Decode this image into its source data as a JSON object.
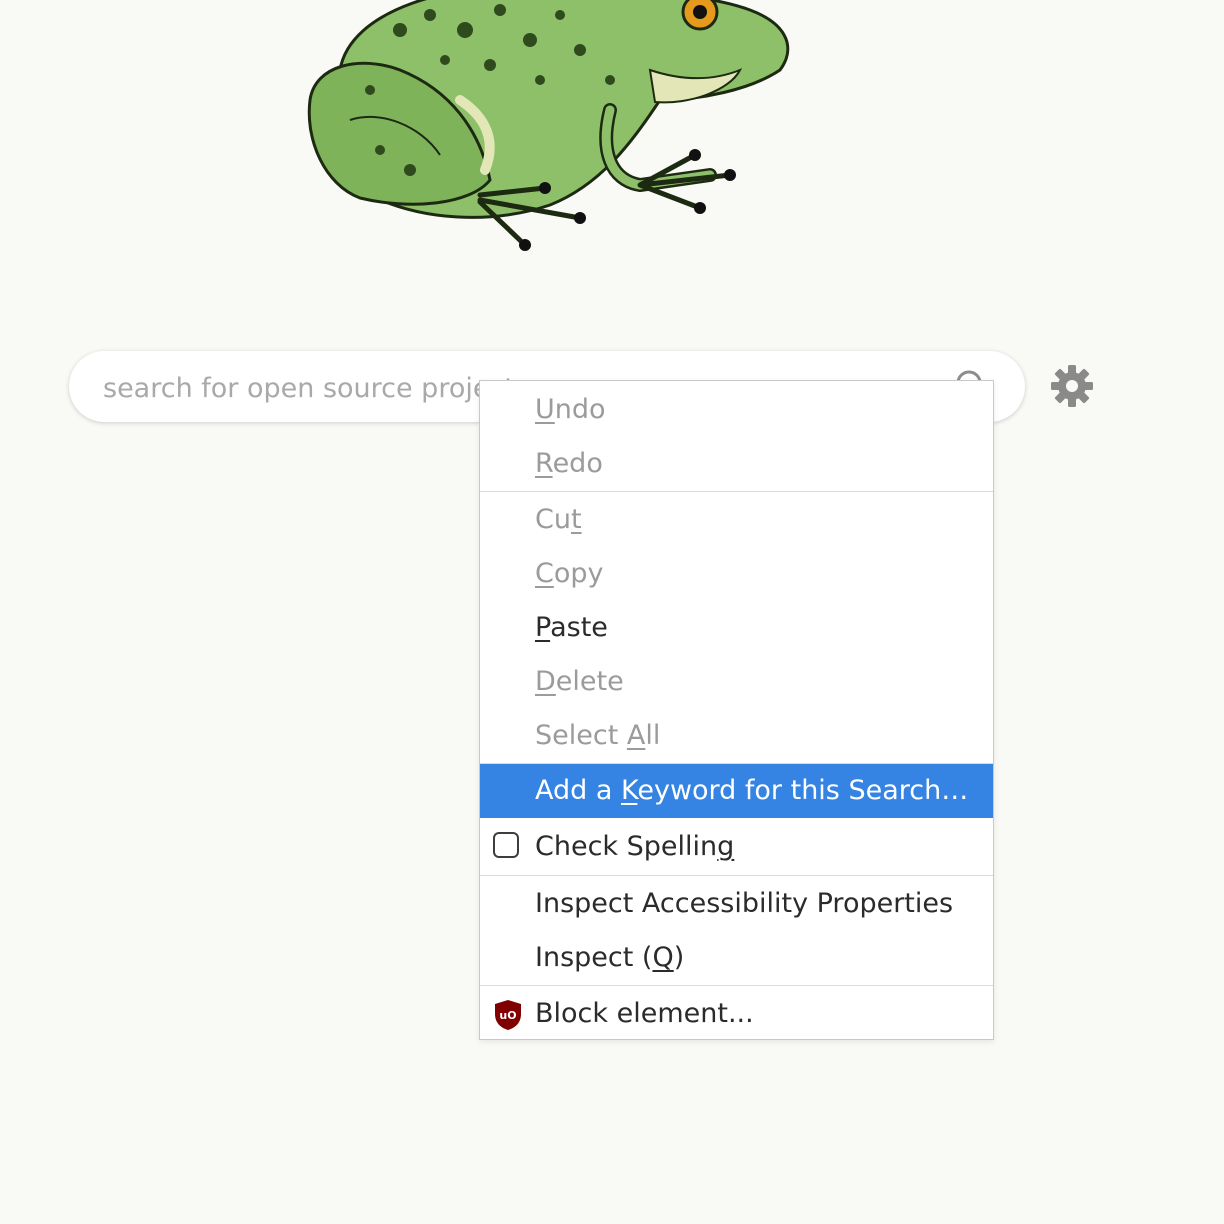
{
  "search": {
    "placeholder": "search for open source projects..."
  },
  "context_menu": {
    "items": [
      {
        "label_parts": [
          "",
          "U",
          "ndo"
        ],
        "enabled": false
      },
      {
        "label_parts": [
          "",
          "R",
          "edo"
        ],
        "enabled": false
      },
      {
        "label_parts": [
          "Cu",
          "t",
          ""
        ],
        "enabled": false
      },
      {
        "label_parts": [
          "",
          "C",
          "opy"
        ],
        "enabled": false
      },
      {
        "label_parts": [
          "",
          "P",
          "aste"
        ],
        "enabled": true
      },
      {
        "label_parts": [
          "",
          "D",
          "elete"
        ],
        "enabled": false
      },
      {
        "label_parts": [
          "Select ",
          "A",
          "ll"
        ],
        "enabled": false
      },
      {
        "label_parts": [
          "Add a ",
          "K",
          "eyword for this Search…"
        ],
        "enabled": true,
        "highlighted": true
      },
      {
        "label_parts": [
          "Check Spellin",
          "g",
          ""
        ],
        "enabled": true,
        "checkbox": true,
        "checked": false
      },
      {
        "label_parts": [
          "Inspect Accessibility Properties",
          "",
          ""
        ],
        "enabled": true
      },
      {
        "label_parts": [
          "Inspect (",
          "Q",
          ")"
        ],
        "enabled": true
      },
      {
        "label_parts": [
          "Block element...",
          "",
          ""
        ],
        "enabled": true,
        "icon": "ublock-shield-icon"
      }
    ]
  },
  "icons": {
    "search": "search-icon",
    "settings": "gear-icon",
    "logo": "frog-logo"
  },
  "colors": {
    "highlight": "#3584e4",
    "page_bg": "#f9f9f5",
    "frog_green": "#8ec06a",
    "ublock_red": "#800000"
  }
}
